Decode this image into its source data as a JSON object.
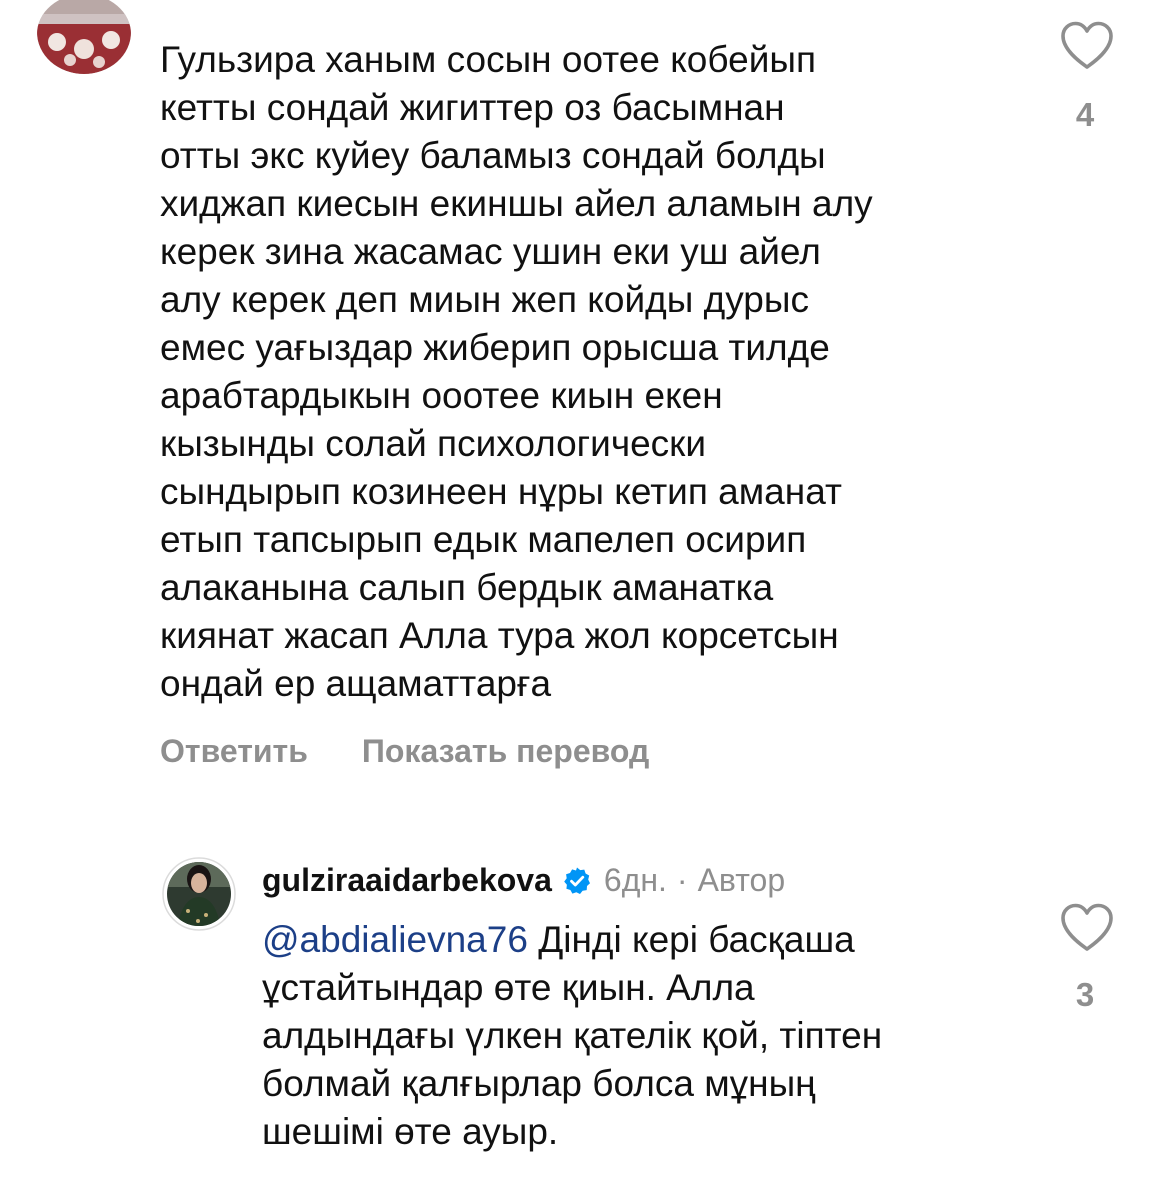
{
  "comment1": {
    "lines": [
      "Гульзира ханым сосын оотее кобейып",
      "кетты сондай жигиттер оз басымнан",
      "отты экс куйеу баламыз сондай болды",
      "хиджап киесын екиншы айел аламын алу",
      "керек зина жасамас ушин еки уш айел",
      "алу керек деп миын жеп койды дурыс",
      "емес уағыздар жиберип орысша тилде",
      "арабтардыкын ооотее киын екен",
      "кызынды солай психологически",
      "сындырып козинеен нұры кетип аманат",
      "етып тапсырып едык мапелеп осирип",
      "алаканына салып бердык аманатка",
      "киянат жасап Алла тура жол корсетсын",
      "ондай ер ащаматтарға"
    ],
    "likes": "4",
    "reply_label": "Ответить",
    "translate_label": "Показать перевод"
  },
  "comment2": {
    "username": "gulziraaidarbekova",
    "time": "6дн.",
    "separator": "·",
    "author_label": "Автор",
    "mention": "@abdialievna76",
    "first_line_rest": " Дінді кері басқаша",
    "lines": [
      "ұстайтындар өте қиын. Алла",
      "алдындағы үлкен қателік қой, тіптен",
      "болмай қалғырлар болса мұның",
      "шешімі өте ауыр."
    ],
    "likes": "3"
  },
  "icons": {
    "like": "heart-outline-icon",
    "verified": "verified-badge-icon",
    "verified_color": "#0095f6"
  },
  "colors": {
    "secondary_text": "#8e8e8e",
    "mention": "#1c3f87"
  }
}
